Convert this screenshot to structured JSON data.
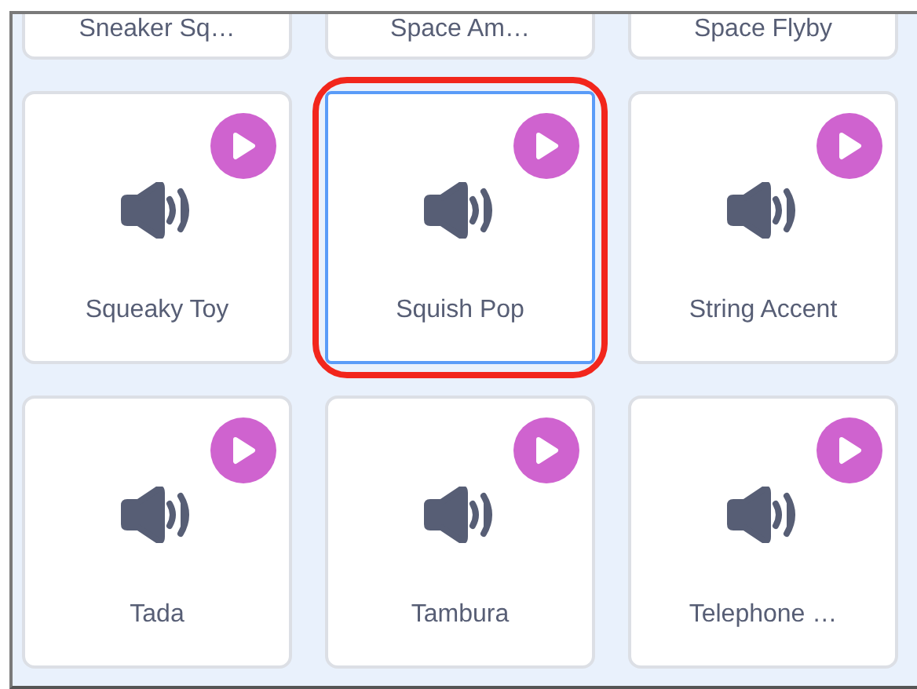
{
  "sounds": [
    {
      "kind": "partial",
      "name": "Sneaker Sq…",
      "selected": false,
      "annotated": false
    },
    {
      "kind": "partial",
      "name": "Space Am…",
      "selected": false,
      "annotated": false
    },
    {
      "kind": "partial",
      "name": "Space Flyby",
      "selected": false,
      "annotated": false
    },
    {
      "kind": "full",
      "name": "Squeaky Toy",
      "selected": false,
      "annotated": false
    },
    {
      "kind": "full",
      "name": "Squish Pop",
      "selected": true,
      "annotated": true
    },
    {
      "kind": "full",
      "name": "String Accent",
      "selected": false,
      "annotated": false
    },
    {
      "kind": "full",
      "name": "Tada",
      "selected": false,
      "annotated": false
    },
    {
      "kind": "full",
      "name": "Tambura",
      "selected": false,
      "annotated": false
    },
    {
      "kind": "full",
      "name": "Telephone …",
      "selected": false,
      "annotated": false
    }
  ]
}
